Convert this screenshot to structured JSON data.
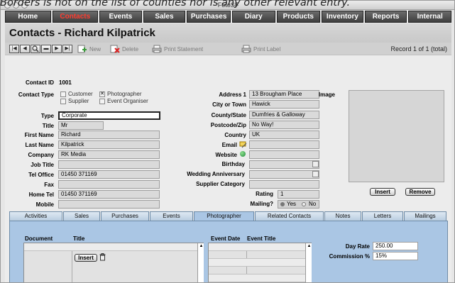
{
  "caption": "Borders is not on the list of counties nor is any other relevant entry.",
  "window": {
    "title": "FotoSF"
  },
  "menu": [
    {
      "label": "Home",
      "active": false
    },
    {
      "label": "Contacts",
      "active": true
    },
    {
      "label": "Events",
      "active": false
    },
    {
      "label": "Sales",
      "active": false
    },
    {
      "label": "Purchases",
      "active": false
    },
    {
      "label": "Diary",
      "active": false
    },
    {
      "label": "Products",
      "active": false
    },
    {
      "label": "Inventory",
      "active": false
    },
    {
      "label": "Reports",
      "active": false
    },
    {
      "label": "Internal",
      "active": false
    }
  ],
  "page": {
    "title": "Contacts - Richard Kilpatrick"
  },
  "toolbar": {
    "new": "New",
    "delete": "Delete",
    "print_statement": "Print Statement",
    "print_label": "Print Label",
    "record": "Record 1 of 1 (total)"
  },
  "contact": {
    "id_label": "Contact ID",
    "id": "1001",
    "type_group_label": "Contact Type",
    "types": {
      "customer": "Customer",
      "photographer": "Photographer",
      "supplier": "Supplier",
      "organiser": "Event Organiser"
    },
    "type_label": "Type",
    "type": "Corporate",
    "title_label": "Title",
    "title": "Mr",
    "first_label": "First Name",
    "first": "Richard",
    "last_label": "Last Name",
    "last": "Kilpatrick",
    "company_label": "Company",
    "company": "RK Media",
    "job_label": "Job Title",
    "job": "",
    "telo_label": "Tel Office",
    "telo": "01450 371169",
    "fax_label": "Fax",
    "fax": "",
    "telh_label": "Home Tel",
    "telh": "01450 371169",
    "mobile_label": "Mobile",
    "mobile": ""
  },
  "address": {
    "addr1_label": "Address 1",
    "addr1": "13 Brougham Place",
    "city_label": "City or Town",
    "city": "Hawick",
    "county_label": "County/State",
    "county": "Dumfries & Galloway",
    "post_label": "Postcode/Zip",
    "post": "No Way!",
    "country_label": "Country",
    "country": "UK",
    "email_label": "Email",
    "email": "",
    "website_label": "Website",
    "website": "",
    "birthday_label": "Birthday",
    "birthday": "",
    "anniv_label": "Wedding Anniversary",
    "anniv": "",
    "supcat_label": "Supplier Category",
    "supcat": "",
    "rating_label": "Rating",
    "rating": "1",
    "mailing_label": "Mailing?",
    "yes": "Yes",
    "no": "No"
  },
  "image": {
    "label": "Image",
    "insert": "Insert",
    "remove": "Remove"
  },
  "tabs": [
    {
      "label": "Activities",
      "active": false
    },
    {
      "label": "Sales",
      "active": false
    },
    {
      "label": "Purchases",
      "active": false
    },
    {
      "label": "Events",
      "active": false
    },
    {
      "label": "Photographer",
      "active": true
    },
    {
      "label": "Related Contacts",
      "active": false
    },
    {
      "label": "Notes",
      "active": false
    },
    {
      "label": "Letters",
      "active": false
    },
    {
      "label": "Mailings",
      "active": false
    }
  ],
  "photographer": {
    "doc_label": "Document",
    "title_label": "Title",
    "insert": "Insert",
    "event_date_label": "Event Date",
    "event_title_label": "Event Title",
    "day_rate_label": "Day Rate",
    "day_rate": "250.00",
    "commission_label": "Commission %",
    "commission": "15%"
  }
}
